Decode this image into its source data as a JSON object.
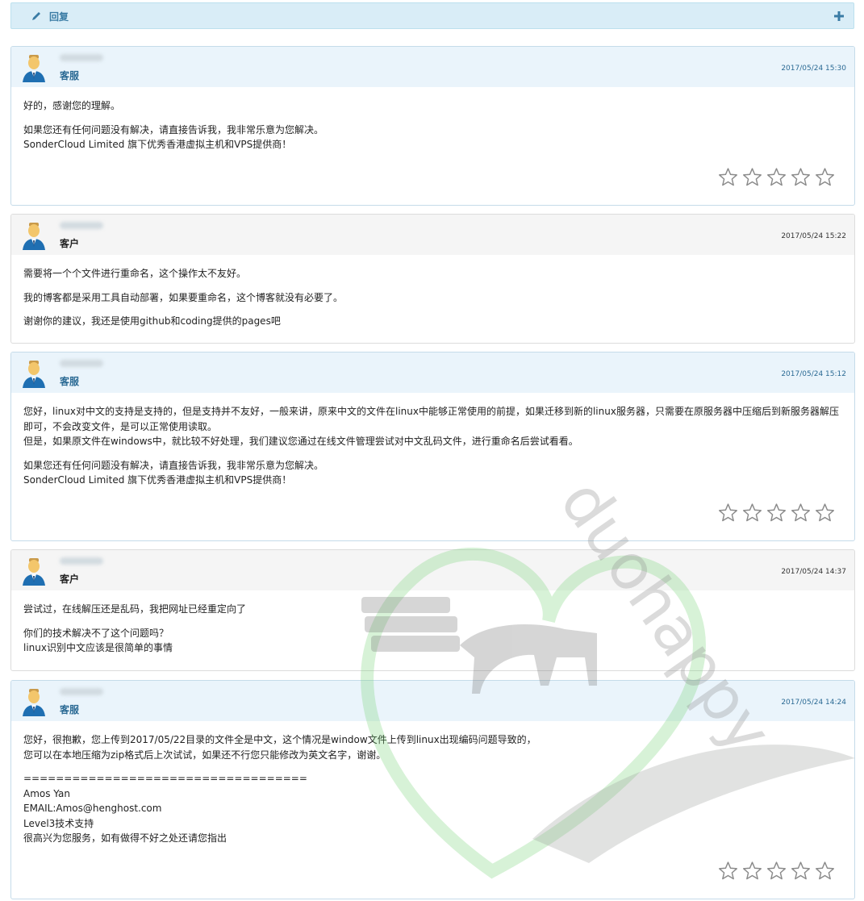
{
  "reply_bar": {
    "label": "回复"
  },
  "messages": [
    {
      "role": "客服",
      "timestamp": "2017/05/24 15:30",
      "paragraphs": [
        "好的，感谢您的理解。",
        "如果您还有任何问题没有解决，请直接告诉我，我非常乐意为您解决。\nSonderCloud Limited 旗下优秀香港虚拟主机和VPS提供商！"
      ],
      "has_rating": true,
      "rating": 0
    },
    {
      "role": "客户",
      "timestamp": "2017/05/24 15:22",
      "paragraphs": [
        "需要将一个个文件进行重命名，这个操作太不友好。",
        "我的博客都是采用工具自动部署，如果要重命名，这个博客就没有必要了。",
        "谢谢你的建议，我还是使用github和coding提供的pages吧"
      ],
      "has_rating": false
    },
    {
      "role": "客服",
      "timestamp": "2017/05/24 15:12",
      "paragraphs": [
        "您好，linux对中文的支持是支持的，但是支持并不友好，一般来讲，原来中文的文件在linux中能够正常使用的前提，如果迁移到新的linux服务器，只需要在原服务器中压缩后到新服务器解压即可，不会改变文件，是可以正常使用读取。\n但是，如果原文件在windows中，就比较不好处理，我们建议您通过在线文件管理尝试对中文乱码文件，进行重命名后尝试看看。",
        "如果您还有任何问题没有解决，请直接告诉我，我非常乐意为您解决。\nSonderCloud Limited 旗下优秀香港虚拟主机和VPS提供商！"
      ],
      "has_rating": true,
      "rating": 0
    },
    {
      "role": "客户",
      "timestamp": "2017/05/24 14:37",
      "paragraphs": [
        "尝试过，在线解压还是乱码，我把网址已经重定向了",
        "你们的技术解决不了这个问题吗？\nlinux识别中文应该是很简单的事情"
      ],
      "has_rating": false
    },
    {
      "role": "客服",
      "timestamp": "2017/05/24 14:24",
      "paragraphs": [
        "您好，很抱歉，您上传到2017/05/22目录的文件全是中文，这个情况是window文件上传到linux出现编码问题导致的，\n您可以在本地压缩为zip格式后上次试试，如果还不行您只能修改为英文名字，谢谢。",
        "===================================\nAmos Yan\nEMAIL:Amos@henghost.com\nLevel3技术支持\n很高兴为您服务，如有做得不好之处还请您指出"
      ],
      "has_rating": true,
      "rating": 0
    }
  ],
  "watermark": {
    "text": "duohappy"
  },
  "colors": {
    "staff_header": "#eaf4fb",
    "client_header": "#f5f5f5",
    "accent": "#2b6a94",
    "reply_bar": "#d9edf7"
  }
}
